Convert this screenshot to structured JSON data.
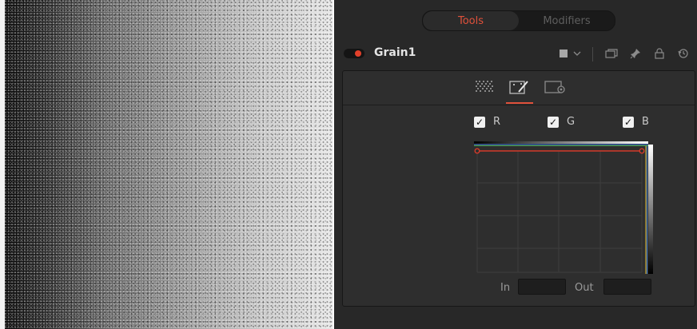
{
  "inspector": {
    "tabs": [
      {
        "label": "Tools",
        "active": true
      },
      {
        "label": "Modifiers",
        "active": false
      }
    ],
    "node": {
      "name": "Grain1",
      "header_icons": [
        "color-swatch-icon",
        "chevron-down-icon",
        "copy-window-icon",
        "pin-icon",
        "lock-icon",
        "reset-icon"
      ]
    },
    "subtabs": [
      "grain-noise-icon",
      "magic-wand-icon",
      "settings-panel-icon"
    ],
    "channels": [
      {
        "label": "R",
        "checked": true
      },
      {
        "label": "G",
        "checked": true
      },
      {
        "label": "B",
        "checked": true
      }
    ],
    "io": {
      "in_label": "In",
      "out_label": "Out",
      "in_value": "",
      "out_value": ""
    },
    "colors": {
      "accent": "#e0513b",
      "power_on": "#e2402a"
    }
  }
}
